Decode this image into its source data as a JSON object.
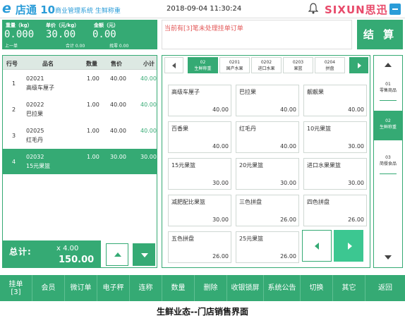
{
  "header": {
    "logo_mark": "e",
    "logo_text": "店通 10",
    "system_title": "商业管理系统 生鲜称重",
    "datetime": "2018-09-04 11:30:24",
    "brand": "SIXUN思迅"
  },
  "scale": {
    "weight_label": "重量（kg）",
    "price_label": "单价（元/kg）",
    "amount_label": "金额（元）",
    "weight": "0.000",
    "price": "30.00",
    "amount": "0.00",
    "prev_label": "上一单",
    "total_label": "合计 0.00",
    "change_label": "找零 0.00"
  },
  "notice": "当前有[3]笔未处理挂单订单",
  "settle_label": "结 算",
  "cart": {
    "headers": [
      "行号",
      "品名",
      "数量",
      "售价",
      "小计"
    ],
    "rows": [
      {
        "no": "1",
        "code": "02021",
        "name": "高级车厘子",
        "qty": "1.00",
        "price": "40.00",
        "subtotal": "40.00"
      },
      {
        "no": "2",
        "code": "02022",
        "name": "巴拉果",
        "qty": "1.00",
        "price": "40.00",
        "subtotal": "40.00"
      },
      {
        "no": "3",
        "code": "02025",
        "name": "红毛丹",
        "qty": "1.00",
        "price": "40.00",
        "subtotal": "40.00"
      },
      {
        "no": "4",
        "code": "02032",
        "name": "15元果篮",
        "qty": "1.00",
        "price": "30.00",
        "subtotal": "30.00"
      }
    ],
    "selected_row": 3,
    "total_label": "总计:",
    "total_qty": "x 4.00",
    "total_amount": "150.00"
  },
  "categories": [
    {
      "code": "02",
      "name": "生鲜称重"
    },
    {
      "code": "0201",
      "name": "国产水果"
    },
    {
      "code": "0202",
      "name": "进口水果"
    },
    {
      "code": "0203",
      "name": "果篮"
    },
    {
      "code": "0204",
      "name": "拼盘"
    }
  ],
  "products": [
    {
      "name": "高级车厘子",
      "price": "40.00"
    },
    {
      "name": "巴拉果",
      "price": "40.00"
    },
    {
      "name": "靓靓果",
      "price": "40.00"
    },
    {
      "name": "百香果",
      "price": "40.00"
    },
    {
      "name": "红毛丹",
      "price": "40.00"
    },
    {
      "name": "10元果篮",
      "price": "30.00"
    },
    {
      "name": "15元果篮",
      "price": "30.00"
    },
    {
      "name": "20元果篮",
      "price": "30.00"
    },
    {
      "name": "进口水果果篮",
      "price": "30.00"
    },
    {
      "name": "减肥配比果篮",
      "price": "30.00"
    },
    {
      "name": "三色拼盘",
      "price": "26.00"
    },
    {
      "name": "四色拼盘",
      "price": "26.00"
    },
    {
      "name": "五色拼盘",
      "price": "26.00"
    },
    {
      "name": "25元果篮",
      "price": "26.00"
    }
  ],
  "side_categories": [
    {
      "code": "01",
      "name": "零售商品"
    },
    {
      "code": "02",
      "name": "生鲜称重"
    },
    {
      "code": "03",
      "name": "简餐食品"
    }
  ],
  "bottom_buttons": [
    "挂单\n[3]",
    "会员",
    "微订单",
    "电子秤",
    "连称",
    "数量",
    "删除",
    "收银锁屏",
    "系统公告",
    "切换",
    "其它",
    "返回"
  ],
  "caption": "生鲜业态--门店销售界面",
  "colors": {
    "primary": "#35aa74",
    "accent": "#2a9cd8",
    "brand": "#e84a6a",
    "notice": "#e35a5a"
  }
}
